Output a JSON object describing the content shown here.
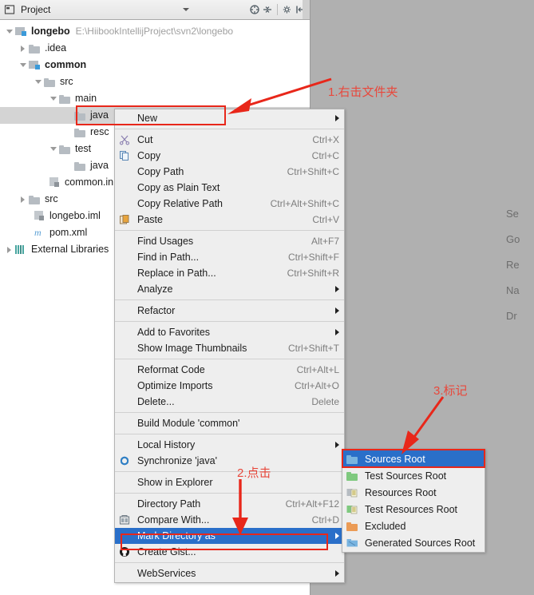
{
  "window": {
    "tool_window_title": "Project"
  },
  "toolbar": {
    "icons": [
      {
        "name": "collapse-all-icon",
        "glyph": "⊛"
      },
      {
        "name": "expand-collapse-icon",
        "glyph": "⌁"
      },
      {
        "name": "settings-gear-icon",
        "glyph": "⚙"
      },
      {
        "name": "hide-window-icon",
        "glyph": "⊦"
      }
    ]
  },
  "tree": {
    "items": [
      {
        "label": "longebo",
        "path": "E:\\HiibookIntellijProject\\svn2\\longebo",
        "indent": 0,
        "twist": "open",
        "icon": "module-icon",
        "bold": true,
        "selected": false
      },
      {
        "label": ".idea",
        "path": "",
        "indent": 1,
        "twist": "closed",
        "icon": "folder-gray-icon",
        "bold": false,
        "selected": false
      },
      {
        "label": "common",
        "path": "",
        "indent": 1,
        "twist": "open",
        "icon": "module-icon",
        "bold": true,
        "selected": false
      },
      {
        "label": "src",
        "path": "",
        "indent": 2,
        "twist": "open",
        "icon": "folder-gray-icon",
        "bold": false,
        "selected": false
      },
      {
        "label": "main",
        "path": "",
        "indent": 3,
        "twist": "open",
        "icon": "folder-gray-icon",
        "bold": false,
        "selected": false
      },
      {
        "label": "java",
        "path": "",
        "indent": 4,
        "twist": "none",
        "icon": "folder-gray-icon",
        "bold": false,
        "selected": true
      },
      {
        "label": "resc",
        "path": "",
        "indent": 4,
        "twist": "none",
        "icon": "folder-gray-icon",
        "bold": false,
        "selected": false
      },
      {
        "label": "test",
        "path": "",
        "indent": 3,
        "twist": "open",
        "icon": "folder-gray-icon",
        "bold": false,
        "selected": false
      },
      {
        "label": "java",
        "path": "",
        "indent": 4,
        "twist": "none",
        "icon": "folder-gray-icon",
        "bold": false,
        "selected": false
      },
      {
        "label": "common.in",
        "path": "",
        "indent": 3,
        "twist": "none",
        "icon": "iml-file-icon",
        "bold": false,
        "selected": false
      },
      {
        "label": "src",
        "path": "",
        "indent": 1,
        "twist": "closed",
        "icon": "folder-gray-icon",
        "bold": false,
        "selected": false
      },
      {
        "label": "longebo.iml",
        "path": "",
        "indent": 2,
        "twist": "none",
        "icon": "iml-file-icon",
        "bold": false,
        "selected": false
      },
      {
        "label": "pom.xml",
        "path": "",
        "indent": 2,
        "twist": "none",
        "icon": "maven-pom-icon",
        "bold": false,
        "selected": false
      },
      {
        "label": "External Libraries",
        "path": "",
        "indent": 0,
        "twist": "closed",
        "icon": "libraries-icon",
        "bold": false,
        "selected": false
      }
    ]
  },
  "context_menu": {
    "items": [
      {
        "type": "item",
        "label": "New",
        "accel": "",
        "icon": "",
        "submenu": true,
        "highlight": false,
        "name": "menu-item-new"
      },
      {
        "type": "separator"
      },
      {
        "type": "item",
        "label": "Cut",
        "accel": "Ctrl+X",
        "icon": "scissors-icon",
        "submenu": false,
        "highlight": false,
        "name": "menu-item-cut"
      },
      {
        "type": "item",
        "label": "Copy",
        "accel": "Ctrl+C",
        "icon": "copy-icon",
        "submenu": false,
        "highlight": false,
        "name": "menu-item-copy"
      },
      {
        "type": "item",
        "label": "Copy Path",
        "accel": "Ctrl+Shift+C",
        "icon": "",
        "submenu": false,
        "highlight": false,
        "name": "menu-item-copy-path"
      },
      {
        "type": "item",
        "label": "Copy as Plain Text",
        "accel": "",
        "icon": "",
        "submenu": false,
        "highlight": false,
        "name": "menu-item-copy-as-plain-text"
      },
      {
        "type": "item",
        "label": "Copy Relative Path",
        "accel": "Ctrl+Alt+Shift+C",
        "icon": "",
        "submenu": false,
        "highlight": false,
        "name": "menu-item-copy-relative-path"
      },
      {
        "type": "item",
        "label": "Paste",
        "accel": "Ctrl+V",
        "icon": "paste-icon",
        "submenu": false,
        "highlight": false,
        "name": "menu-item-paste"
      },
      {
        "type": "separator"
      },
      {
        "type": "item",
        "label": "Find Usages",
        "accel": "Alt+F7",
        "icon": "",
        "submenu": false,
        "highlight": false,
        "name": "menu-item-find-usages"
      },
      {
        "type": "item",
        "label": "Find in Path...",
        "accel": "Ctrl+Shift+F",
        "icon": "",
        "submenu": false,
        "highlight": false,
        "name": "menu-item-find-in-path"
      },
      {
        "type": "item",
        "label": "Replace in Path...",
        "accel": "Ctrl+Shift+R",
        "icon": "",
        "submenu": false,
        "highlight": false,
        "name": "menu-item-replace-in-path"
      },
      {
        "type": "item",
        "label": "Analyze",
        "accel": "",
        "icon": "",
        "submenu": true,
        "highlight": false,
        "name": "menu-item-analyze"
      },
      {
        "type": "separator"
      },
      {
        "type": "item",
        "label": "Refactor",
        "accel": "",
        "icon": "",
        "submenu": true,
        "highlight": false,
        "name": "menu-item-refactor"
      },
      {
        "type": "separator"
      },
      {
        "type": "item",
        "label": "Add to Favorites",
        "accel": "",
        "icon": "",
        "submenu": true,
        "highlight": false,
        "name": "menu-item-add-to-favorites"
      },
      {
        "type": "item",
        "label": "Show Image Thumbnails",
        "accel": "Ctrl+Shift+T",
        "icon": "",
        "submenu": false,
        "highlight": false,
        "name": "menu-item-show-image-thumbnails"
      },
      {
        "type": "separator"
      },
      {
        "type": "item",
        "label": "Reformat Code",
        "accel": "Ctrl+Alt+L",
        "icon": "",
        "submenu": false,
        "highlight": false,
        "name": "menu-item-reformat-code"
      },
      {
        "type": "item",
        "label": "Optimize Imports",
        "accel": "Ctrl+Alt+O",
        "icon": "",
        "submenu": false,
        "highlight": false,
        "name": "menu-item-optimize-imports"
      },
      {
        "type": "item",
        "label": "Delete...",
        "accel": "Delete",
        "icon": "",
        "submenu": false,
        "highlight": false,
        "name": "menu-item-delete"
      },
      {
        "type": "separator"
      },
      {
        "type": "item",
        "label": "Build Module 'common'",
        "accel": "",
        "icon": "",
        "submenu": false,
        "highlight": false,
        "name": "menu-item-build-module"
      },
      {
        "type": "separator"
      },
      {
        "type": "item",
        "label": "Local History",
        "accel": "",
        "icon": "",
        "submenu": true,
        "highlight": false,
        "name": "menu-item-local-history"
      },
      {
        "type": "item",
        "label": "Synchronize 'java'",
        "accel": "",
        "icon": "synchronize-icon",
        "submenu": false,
        "highlight": false,
        "name": "menu-item-synchronize"
      },
      {
        "type": "separator"
      },
      {
        "type": "item",
        "label": "Show in Explorer",
        "accel": "",
        "icon": "",
        "submenu": false,
        "highlight": false,
        "name": "menu-item-show-in-explorer"
      },
      {
        "type": "separator"
      },
      {
        "type": "item",
        "label": "Directory Path",
        "accel": "Ctrl+Alt+F12",
        "icon": "",
        "submenu": false,
        "highlight": false,
        "name": "menu-item-directory-path"
      },
      {
        "type": "item",
        "label": "Compare With...",
        "accel": "Ctrl+D",
        "icon": "compare-icon",
        "submenu": false,
        "highlight": false,
        "name": "menu-item-compare-with"
      },
      {
        "type": "item",
        "label": "Mark Directory as",
        "accel": "",
        "icon": "",
        "submenu": true,
        "highlight": true,
        "name": "menu-item-mark-directory-as"
      },
      {
        "type": "item",
        "label": "Create Gist...",
        "accel": "",
        "icon": "github-icon",
        "submenu": false,
        "highlight": false,
        "name": "menu-item-create-gist"
      },
      {
        "type": "separator"
      },
      {
        "type": "item",
        "label": "WebServices",
        "accel": "",
        "icon": "",
        "submenu": true,
        "highlight": false,
        "name": "menu-item-webservices"
      }
    ]
  },
  "sub_menu": {
    "items": [
      {
        "label": "Sources Root",
        "icon": "folder-blue-icon",
        "highlight": true,
        "name": "submenu-item-sources-root"
      },
      {
        "label": "Test Sources Root",
        "icon": "folder-green-icon",
        "highlight": false,
        "name": "submenu-item-test-sources-root"
      },
      {
        "label": "Resources Root",
        "icon": "resources-icon",
        "highlight": false,
        "name": "submenu-item-resources-root"
      },
      {
        "label": "Test Resources Root",
        "icon": "test-resources-icon",
        "highlight": false,
        "name": "submenu-item-test-resources-root"
      },
      {
        "label": "Excluded",
        "icon": "folder-orange-icon",
        "highlight": false,
        "name": "submenu-item-excluded"
      },
      {
        "label": "Generated Sources Root",
        "icon": "folder-blue-icon",
        "highlight": false,
        "name": "submenu-item-generated-sources-root"
      }
    ]
  },
  "annotations": [
    {
      "name": "annotation-step-1",
      "text": "1.右击文件夹"
    },
    {
      "name": "annotation-step-2",
      "text": "2.点击"
    },
    {
      "name": "annotation-step-3",
      "text": "3.标记"
    }
  ],
  "background_hints": [
    {
      "text": "Se"
    },
    {
      "text": "Go"
    },
    {
      "text": "Re"
    },
    {
      "text": "Na"
    },
    {
      "text": "Dr"
    }
  ],
  "colors": {
    "highlight_blue": "#2a6fc9",
    "annotation_red": "#e8483c",
    "menu_bg": "#eeeeee",
    "editor_bg": "#b0b0b0"
  }
}
